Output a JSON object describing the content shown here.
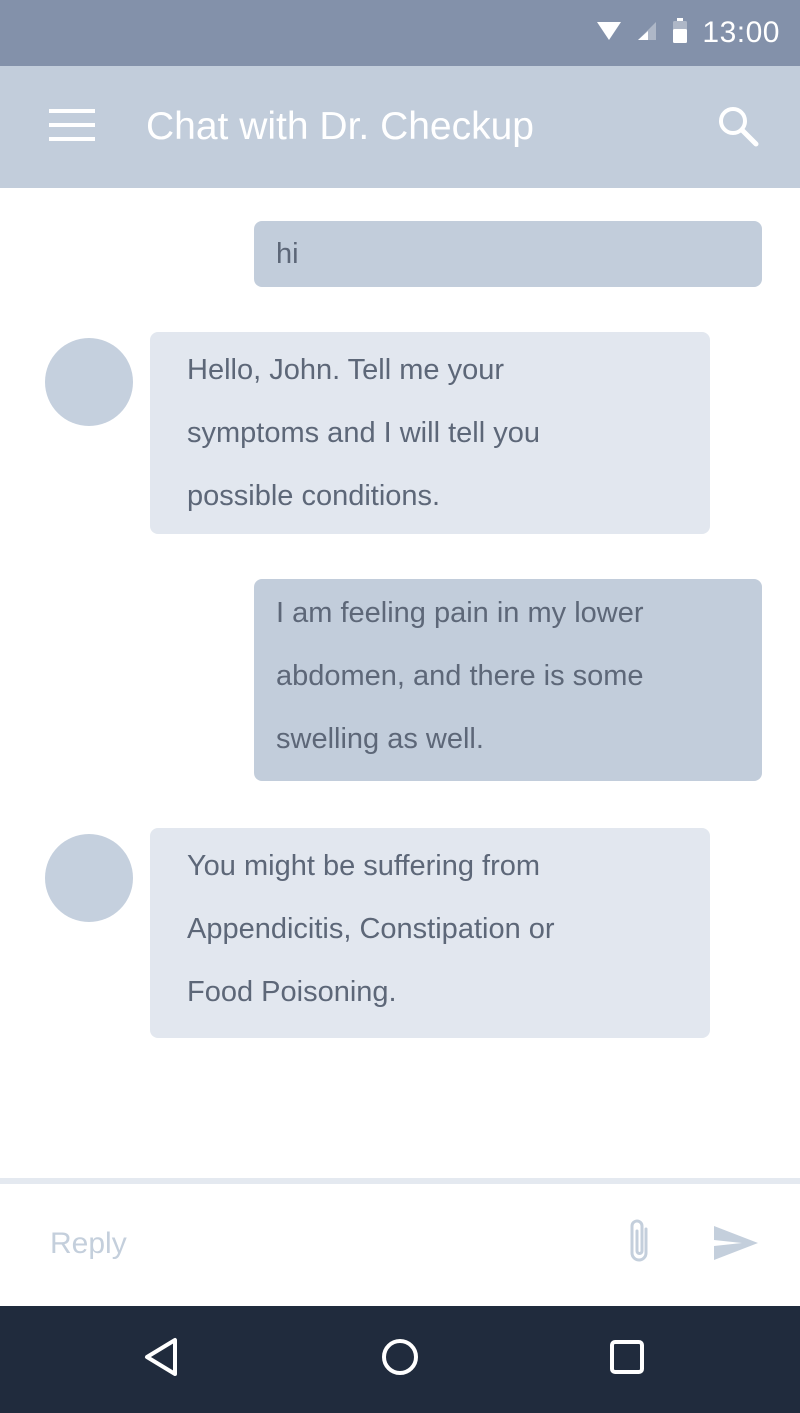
{
  "status_bar": {
    "time": "13:00",
    "icons": [
      "wifi-icon",
      "cellular-signal-icon",
      "battery-icon"
    ]
  },
  "app_bar": {
    "title": "Chat with Dr. Checkup",
    "menu_icon": "hamburger-menu-icon",
    "search_icon": "search-icon"
  },
  "messages": [
    {
      "sender": "user",
      "text": "hi"
    },
    {
      "sender": "bot",
      "lines": [
        "Hello, John. Tell me your",
        "symptoms and I will tell you",
        "possible conditions."
      ]
    },
    {
      "sender": "user",
      "lines": [
        "I am feeling pain in my lower",
        "abdomen, and there is some",
        "swelling as well."
      ]
    },
    {
      "sender": "bot",
      "lines": [
        "You might be suffering from",
        "Appendicitis, Constipation or",
        "Food Poisoning."
      ]
    }
  ],
  "reply": {
    "placeholder": "Reply",
    "value": "",
    "attach_icon": "paperclip-icon",
    "send_icon": "send-icon"
  },
  "nav_bar": {
    "icons": [
      "back-icon",
      "home-icon",
      "recents-icon"
    ]
  },
  "colors": {
    "status_bar": "#8391aa",
    "app_bar": "#c2cddb",
    "user_bubble": "#c2cddb",
    "bot_bubble": "#e2e7ef",
    "avatar": "#c5d0de",
    "nav_bar": "#202b3d",
    "message_text": "#5d6778"
  }
}
